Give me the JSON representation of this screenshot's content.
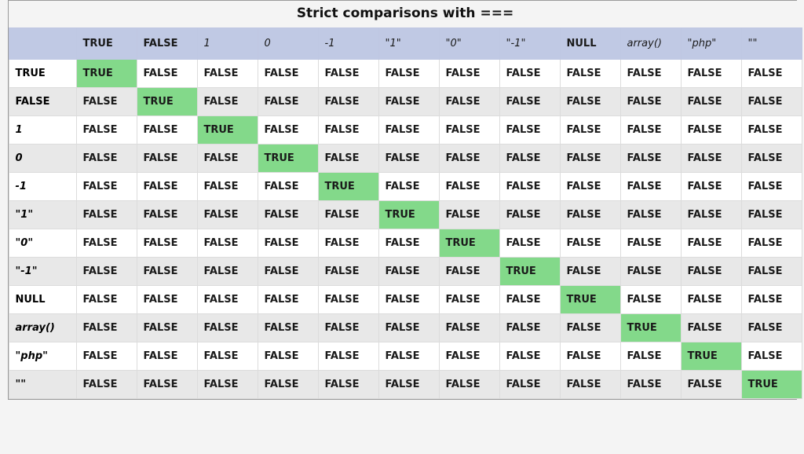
{
  "title": "Strict comparisons with ===",
  "types": [
    {
      "label": "TRUE",
      "kind": "bool"
    },
    {
      "label": "FALSE",
      "kind": "bool"
    },
    {
      "label": "1",
      "kind": "int"
    },
    {
      "label": "0",
      "kind": "int"
    },
    {
      "label": "-1",
      "kind": "int"
    },
    {
      "label": "\"1\"",
      "kind": "str"
    },
    {
      "label": "\"0\"",
      "kind": "str"
    },
    {
      "label": "\"-1\"",
      "kind": "str"
    },
    {
      "label": "NULL",
      "kind": "null"
    },
    {
      "label": "array()",
      "kind": "expr"
    },
    {
      "label": "\"php\"",
      "kind": "str"
    },
    {
      "label": "\"\"",
      "kind": "str"
    }
  ],
  "true_label": "TRUE",
  "false_label": "FALSE",
  "chart_data": {
    "type": "table",
    "title": "Strict comparisons with ===",
    "row_labels": [
      "TRUE",
      "FALSE",
      "1",
      "0",
      "-1",
      "\"1\"",
      "\"0\"",
      "\"-1\"",
      "NULL",
      "array()",
      "\"php\"",
      "\"\""
    ],
    "column_labels": [
      "TRUE",
      "FALSE",
      "1",
      "0",
      "-1",
      "\"1\"",
      "\"0\"",
      "\"-1\"",
      "NULL",
      "array()",
      "\"php\"",
      "\"\""
    ],
    "cells": [
      [
        "TRUE",
        "FALSE",
        "FALSE",
        "FALSE",
        "FALSE",
        "FALSE",
        "FALSE",
        "FALSE",
        "FALSE",
        "FALSE",
        "FALSE",
        "FALSE"
      ],
      [
        "FALSE",
        "TRUE",
        "FALSE",
        "FALSE",
        "FALSE",
        "FALSE",
        "FALSE",
        "FALSE",
        "FALSE",
        "FALSE",
        "FALSE",
        "FALSE"
      ],
      [
        "FALSE",
        "FALSE",
        "TRUE",
        "FALSE",
        "FALSE",
        "FALSE",
        "FALSE",
        "FALSE",
        "FALSE",
        "FALSE",
        "FALSE",
        "FALSE"
      ],
      [
        "FALSE",
        "FALSE",
        "FALSE",
        "TRUE",
        "FALSE",
        "FALSE",
        "FALSE",
        "FALSE",
        "FALSE",
        "FALSE",
        "FALSE",
        "FALSE"
      ],
      [
        "FALSE",
        "FALSE",
        "FALSE",
        "FALSE",
        "TRUE",
        "FALSE",
        "FALSE",
        "FALSE",
        "FALSE",
        "FALSE",
        "FALSE",
        "FALSE"
      ],
      [
        "FALSE",
        "FALSE",
        "FALSE",
        "FALSE",
        "FALSE",
        "TRUE",
        "FALSE",
        "FALSE",
        "FALSE",
        "FALSE",
        "FALSE",
        "FALSE"
      ],
      [
        "FALSE",
        "FALSE",
        "FALSE",
        "FALSE",
        "FALSE",
        "FALSE",
        "TRUE",
        "FALSE",
        "FALSE",
        "FALSE",
        "FALSE",
        "FALSE"
      ],
      [
        "FALSE",
        "FALSE",
        "FALSE",
        "FALSE",
        "FALSE",
        "FALSE",
        "FALSE",
        "TRUE",
        "FALSE",
        "FALSE",
        "FALSE",
        "FALSE"
      ],
      [
        "FALSE",
        "FALSE",
        "FALSE",
        "FALSE",
        "FALSE",
        "FALSE",
        "FALSE",
        "FALSE",
        "TRUE",
        "FALSE",
        "FALSE",
        "FALSE"
      ],
      [
        "FALSE",
        "FALSE",
        "FALSE",
        "FALSE",
        "FALSE",
        "FALSE",
        "FALSE",
        "FALSE",
        "FALSE",
        "TRUE",
        "FALSE",
        "FALSE"
      ],
      [
        "FALSE",
        "FALSE",
        "FALSE",
        "FALSE",
        "FALSE",
        "FALSE",
        "FALSE",
        "FALSE",
        "FALSE",
        "FALSE",
        "TRUE",
        "FALSE"
      ],
      [
        "FALSE",
        "FALSE",
        "FALSE",
        "FALSE",
        "FALSE",
        "FALSE",
        "FALSE",
        "FALSE",
        "FALSE",
        "FALSE",
        "FALSE",
        "TRUE"
      ]
    ]
  }
}
